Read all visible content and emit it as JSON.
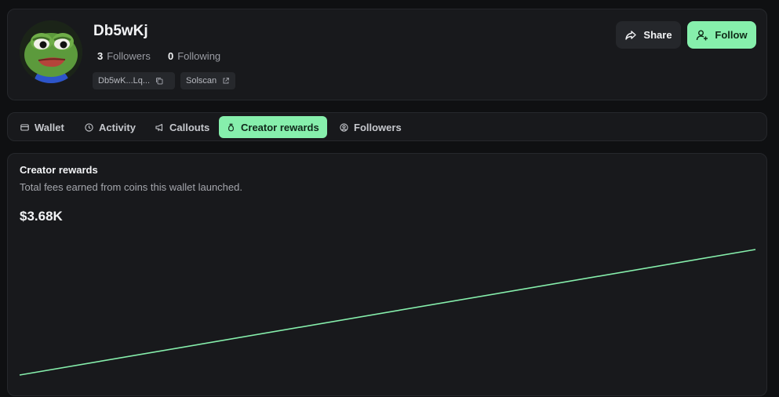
{
  "profile": {
    "username": "Db5wKj",
    "followers_count": "3",
    "followers_label": "Followers",
    "following_count": "0",
    "following_label": "Following",
    "address_short": "Db5wK...Lq...",
    "solscan_label": "Solscan",
    "avatar_icon": "pepe-frog-avatar"
  },
  "actions": {
    "share_label": "Share",
    "follow_label": "Follow"
  },
  "tabs": [
    {
      "label": "Wallet",
      "icon": "wallet-icon"
    },
    {
      "label": "Activity",
      "icon": "clock-icon"
    },
    {
      "label": "Callouts",
      "icon": "megaphone-icon"
    },
    {
      "label": "Creator rewards",
      "icon": "money-bag-icon",
      "active": true
    },
    {
      "label": "Followers",
      "icon": "user-circle-icon"
    }
  ],
  "rewards": {
    "title": "Creator rewards",
    "subtitle": "Total fees earned from coins this wallet launched.",
    "total": "$3.68K"
  },
  "colors": {
    "accent": "#86efac",
    "background": "#0f1012",
    "card": "#18191c"
  },
  "chart_data": {
    "type": "line",
    "x": [
      0,
      1
    ],
    "values": [
      0,
      3680
    ],
    "ylim": [
      0,
      3680
    ],
    "grid": false,
    "color": "#86efac"
  }
}
